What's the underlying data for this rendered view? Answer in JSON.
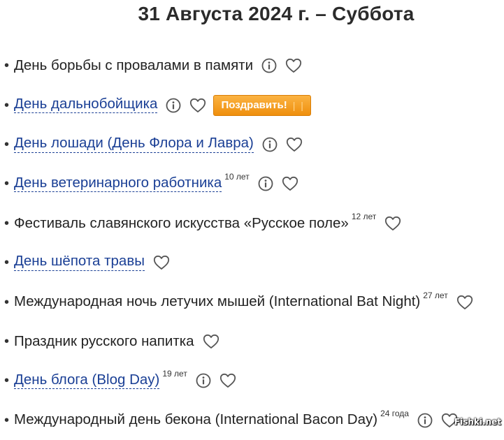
{
  "page": {
    "title": "31 Августа 2024 г. – Суббота"
  },
  "items": [
    {
      "name": "День борьбы с провалами в памяти",
      "link": false,
      "years": "",
      "info": true,
      "congrats": false
    },
    {
      "name": "День дальнобойщика",
      "link": true,
      "years": "",
      "info": true,
      "congrats": true
    },
    {
      "name": "День лошади (День Флора и Лавра)",
      "link": true,
      "years": "",
      "info": true,
      "congrats": false
    },
    {
      "name": "День ветеринарного работника",
      "link": true,
      "years": "10 лет",
      "info": true,
      "congrats": false
    },
    {
      "name": "Фестиваль славянского искусства «Русское поле»",
      "link": false,
      "years": "12 лет",
      "info": false,
      "congrats": false
    },
    {
      "name": "День шёпота травы",
      "link": true,
      "years": "",
      "info": false,
      "congrats": false
    },
    {
      "name": "Международная ночь летучих мышей (International Bat Night)",
      "link": false,
      "years": "27 лет",
      "info": false,
      "congrats": false
    },
    {
      "name": "Праздник русского напитка",
      "link": false,
      "years": "",
      "info": false,
      "congrats": false
    },
    {
      "name": "День блога (Blog Day)",
      "link": true,
      "years": "19 лет",
      "info": true,
      "congrats": false
    },
    {
      "name": "Международный день бекона (International Bacon Day)",
      "link": false,
      "years": "24 года",
      "info": true,
      "congrats": false
    }
  ],
  "congrats_button": {
    "label": "Поздравить!",
    "bars": "| |"
  },
  "icons": {
    "info": "info-icon",
    "favorite": "heart-icon"
  },
  "colors": {
    "link": "#1a3f95",
    "text": "#222222",
    "button": "#f39c1a",
    "icon": "#555555"
  },
  "watermark": "Fishki.net"
}
